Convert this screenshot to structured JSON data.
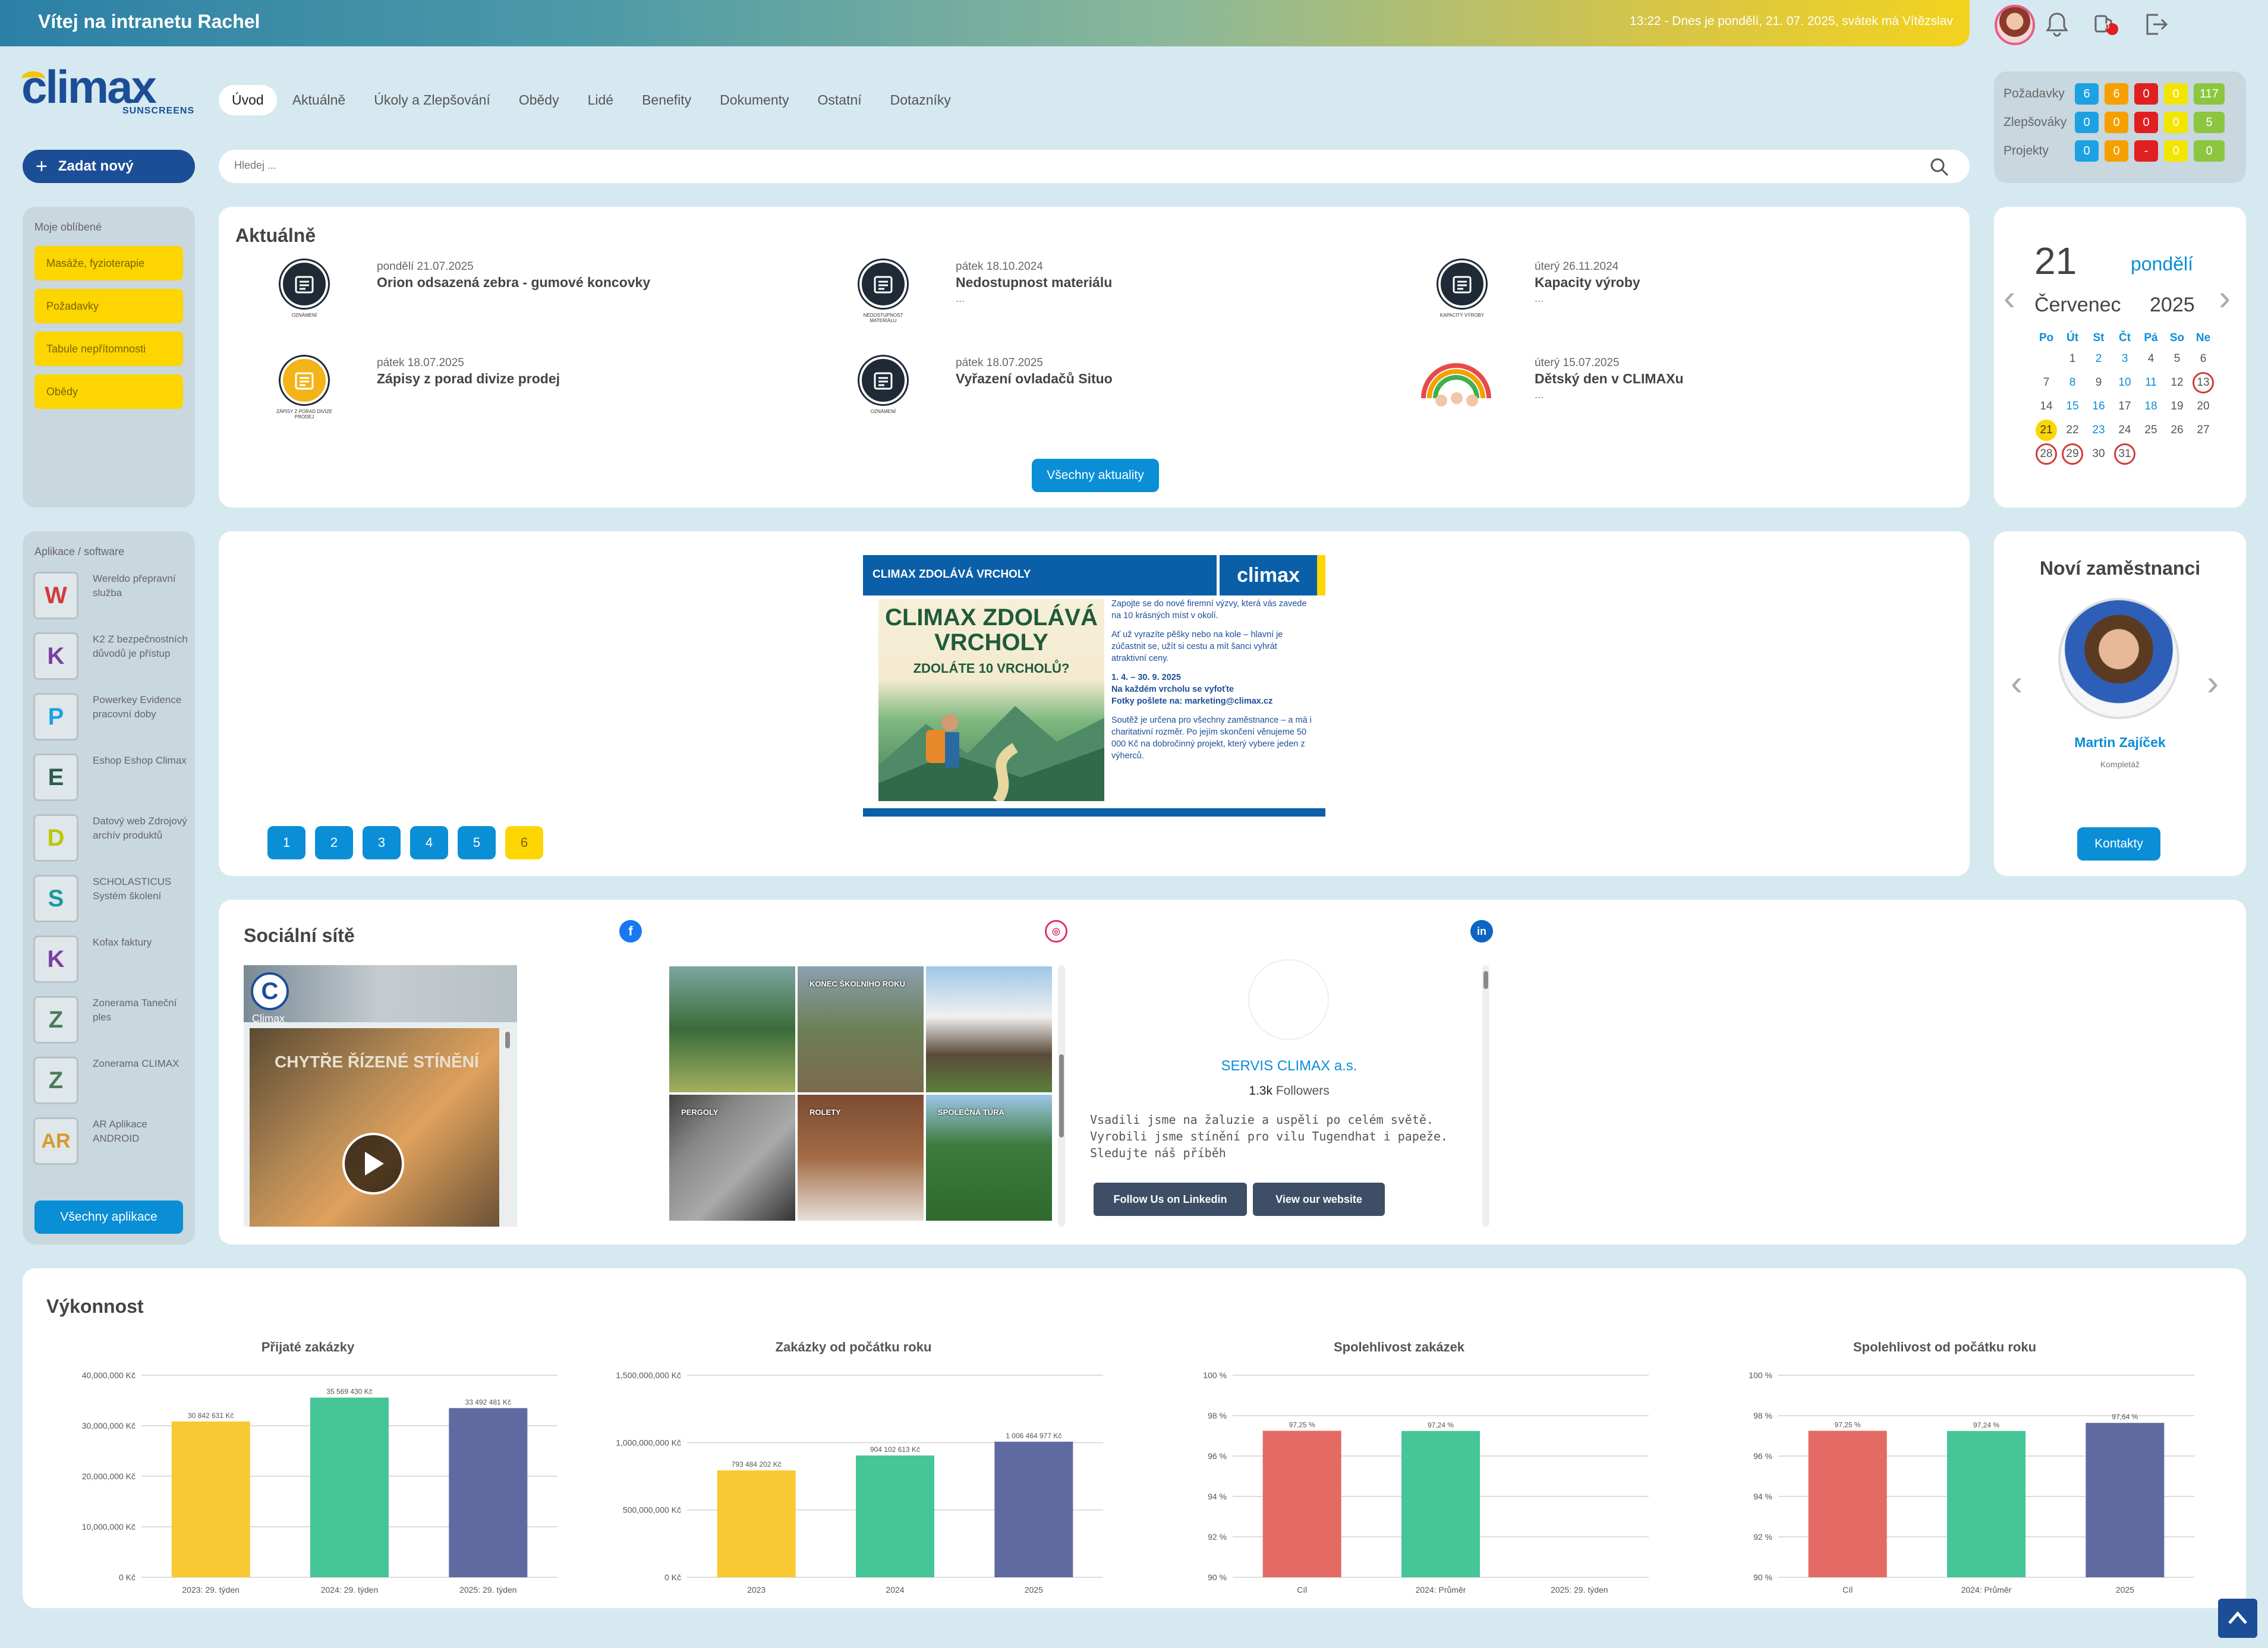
{
  "header": {
    "welcome": "Vítej na intranetu Rachel",
    "datetime": "13:22 - Dnes je pondělí, 21. 07. 2025, svátek má Vítězslav",
    "notif_count": "0"
  },
  "logo": {
    "main": "climax",
    "sub": "SUNSCREENS"
  },
  "nav": [
    "Úvod",
    "Aktuálně",
    "Úkoly a Zlepšování",
    "Obědy",
    "Lidé",
    "Benefity",
    "Dokumenty",
    "Ostatní",
    "Dotazníky"
  ],
  "counters": [
    {
      "label": "Požadavky",
      "values": [
        "6",
        "6",
        "0",
        "0",
        "117"
      ]
    },
    {
      "label": "Zlepšováky",
      "values": [
        "0",
        "0",
        "0",
        "0",
        "5"
      ]
    },
    {
      "label": "Projekty",
      "values": [
        "0",
        "0",
        "-",
        "0",
        "0"
      ]
    }
  ],
  "counter_colors": [
    "#1da1e2",
    "#f5a000",
    "#e02020",
    "#f2e600",
    "#8cc63f"
  ],
  "new_button": "Zadat nový",
  "search": {
    "placeholder": "Hledej ..."
  },
  "favorites": {
    "title": "Moje oblíbené",
    "items": [
      "Masáže, fyzioterapie",
      "Požadavky",
      "Tabule nepřítomnosti",
      "Obědy"
    ]
  },
  "news": {
    "title": "Aktuálně",
    "items": [
      {
        "date": "pondělí 21.07.2025",
        "title": "Orion odsazená zebra - gumové koncovky",
        "dots": "",
        "caption": "OZNÁMENÍ"
      },
      {
        "date": "pátek 18.10.2024",
        "title": "Nedostupnost materiálu",
        "dots": "...",
        "caption": "NEDOSTUPNOST MATERIÁLU"
      },
      {
        "date": "úterý 26.11.2024",
        "title": "Kapacity výroby",
        "dots": "...",
        "caption": "KAPACITY VÝROBY"
      },
      {
        "date": "pátek 18.07.2025",
        "title": "Zápisy z porad divize prodej",
        "dots": "",
        "caption": "ZÁPISY Z PORAD DIVIZE PRODEJ"
      },
      {
        "date": "pátek 18.07.2025",
        "title": "Vyřazení ovladačů Situo",
        "dots": "",
        "caption": "OZNÁMENÍ"
      },
      {
        "date": "úterý 15.07.2025",
        "title": "Dětský den v CLIMAXu",
        "dots": "...",
        "caption": ""
      }
    ],
    "all_button": "Všechny aktuality"
  },
  "calendar": {
    "day": "21",
    "day_name": "pondělí",
    "month": "Červenec",
    "year": "2025",
    "headers": [
      "Po",
      "Út",
      "St",
      "Čt",
      "Pá",
      "So",
      "Ne"
    ],
    "rows": [
      [
        "",
        "1",
        "2",
        "3",
        "4",
        "5",
        "6"
      ],
      [
        "7",
        "8",
        "9",
        "10",
        "11",
        "12",
        "13"
      ],
      [
        "14",
        "15",
        "16",
        "17",
        "18",
        "19",
        "20"
      ],
      [
        "21",
        "22",
        "23",
        "24",
        "25",
        "26",
        "27"
      ],
      [
        "28",
        "29",
        "30",
        "31",
        "",
        "",
        ""
      ]
    ]
  },
  "apps": {
    "title": "Aplikace / software",
    "items": [
      {
        "letter": "W",
        "color": "#d23b3b",
        "text": "Wereldo přepravní služba"
      },
      {
        "letter": "K",
        "color": "#7b3fa0",
        "text": "K2 Z bezpečnostních důvodů je přístup"
      },
      {
        "letter": "P",
        "color": "#1da1e2",
        "text": "Powerkey Evidence pracovní doby"
      },
      {
        "letter": "E",
        "color": "#2b5b4f",
        "text": "Eshop Eshop Climax"
      },
      {
        "letter": "D",
        "color": "#b9c900",
        "text": "Datový web Zdrojový archív produktů"
      },
      {
        "letter": "S",
        "color": "#1a9a9a",
        "text": "SCHOLASTICUS Systém školení"
      },
      {
        "letter": "K",
        "color": "#7b3fa0",
        "text": "Kofax faktury"
      },
      {
        "letter": "Z",
        "color": "#4a7a5a",
        "text": "Zonerama Taneční ples"
      },
      {
        "letter": "Z",
        "color": "#4a7a5a",
        "text": "Zonerama CLIMAX"
      },
      {
        "letter": "AR",
        "color": "#d79a2b",
        "text": "AR Aplikace ANDROID"
      }
    ],
    "all_button": "Všechny aplikace"
  },
  "promo": {
    "header": "CLIMAX ZDOLÁVÁ VRCHOLY",
    "logo": "climax",
    "big_title": "CLIMAX ZDOLÁVÁ VRCHOLY",
    "question": "ZDOLÁTE 10 VRCHOLŮ?",
    "p1": "Zapojte se do nové firemní výzvy, která vás zavede na 10 krásných míst v okolí.",
    "p2": "Ať už vyrazíte pěšky nebo na kole – hlavní je zúčastnit se, užít si cestu a mít šanci vyhrát atraktivní ceny.",
    "p3": "1. 4. – 30. 9. 2025",
    "p4": "Na každém vrcholu se vyfoťte",
    "p5": "Fotky pošlete na: marketing@climax.cz",
    "p6": "Soutěž je určena pro všechny zaměstnance – a má i charitativní rozměr. Po jejím skončení věnujeme 50 000 Kč na dobročinný projekt, který vybere jeden z výherců.",
    "pages": [
      "1",
      "2",
      "3",
      "4",
      "5",
      "6"
    ],
    "active_page": "6"
  },
  "employees": {
    "title": "Noví zaměstnanci",
    "name": "Martin Zajíček",
    "dept": "Kompletáž",
    "button": "Kontakty"
  },
  "social": {
    "title": "Sociální sítě",
    "fb_video_title": "CHYTŘE ŘÍZENÉ STÍNĚNÍ",
    "fb_page": "Climax",
    "instagram": [
      "",
      "KONEC ŠKOLNÍHO ROKU",
      "",
      "PERGOLY",
      "ROLETY",
      "SPOLEČNÁ TÚRA"
    ],
    "linkedin": {
      "name": "SERVIS CLIMAX a.s.",
      "followers_count": "1.3k",
      "followers_label": "Followers",
      "desc": "Vsadili jsme na žaluzie a uspěli po celém světě. Vyrobili jsme stínění pro vilu Tugendhat i papeže. Sledujte náš příběh",
      "follow_btn": "Follow Us on Linkedin",
      "website_btn": "View our website"
    }
  },
  "performance": {
    "title": "Výkonnost"
  },
  "chart_data": [
    {
      "type": "bar",
      "title": "Přijaté zakázky",
      "categories": [
        "2023: 29. týden",
        "2024: 29. týden",
        "2025: 29. týden"
      ],
      "values": [
        30842631,
        35569430,
        33492481
      ],
      "labels": [
        "30 842 631 Kč",
        "35 569 430 Kč",
        "33 492 481 Kč"
      ],
      "ylim": [
        0,
        40000000
      ],
      "ticks": [
        0,
        10000000,
        20000000,
        30000000,
        40000000
      ],
      "tick_labels": [
        "0 Kč",
        "10,000,000 Kč",
        "20,000,000 Kč",
        "30,000,000 Kč",
        "40,000,000 Kč"
      ],
      "colors": [
        "#f9c933",
        "#46c596",
        "#5f6ba0"
      ]
    },
    {
      "type": "bar",
      "title": "Zakázky od počátku roku",
      "categories": [
        "2023",
        "2024",
        "2025"
      ],
      "values": [
        793484202,
        904102613,
        1006464977
      ],
      "labels": [
        "793 484 202 Kč",
        "904 102 613 Kč",
        "1 006 464 977 Kč"
      ],
      "ylim": [
        0,
        1500000000
      ],
      "ticks": [
        0,
        500000000,
        1000000000,
        1500000000
      ],
      "tick_labels": [
        "0 Kč",
        "500,000,000 Kč",
        "1,000,000,000 Kč",
        "1,500,000,000 Kč"
      ],
      "colors": [
        "#f9c933",
        "#46c596",
        "#5f6ba0"
      ]
    },
    {
      "type": "bar",
      "title": "Spolehlivost zakázek",
      "categories": [
        "Cíl",
        "2024: Průměr",
        "2025: 29. týden"
      ],
      "values": [
        97.25,
        97.24,
        null
      ],
      "labels": [
        "97,25 %",
        "97,24 %",
        ""
      ],
      "ylim": [
        90,
        100
      ],
      "ticks": [
        90,
        92,
        94,
        96,
        98,
        100
      ],
      "tick_labels": [
        "90 %",
        "92 %",
        "94 %",
        "96 %",
        "98 %",
        "100 %"
      ],
      "colors": [
        "#e36b64",
        "#46c596",
        "#5f6ba0"
      ]
    },
    {
      "type": "bar",
      "title": "Spolehlivost od počátku roku",
      "categories": [
        "Cíl",
        "2024: Průměr",
        "2025"
      ],
      "values": [
        97.25,
        97.24,
        97.64
      ],
      "labels": [
        "97,25 %",
        "97,24 %",
        "97,64 %"
      ],
      "ylim": [
        90,
        100
      ],
      "ticks": [
        90,
        92,
        94,
        96,
        98,
        100
      ],
      "tick_labels": [
        "90 %",
        "92 %",
        "94 %",
        "96 %",
        "98 %",
        "100 %"
      ],
      "colors": [
        "#e36b64",
        "#46c596",
        "#5f6ba0"
      ]
    }
  ]
}
